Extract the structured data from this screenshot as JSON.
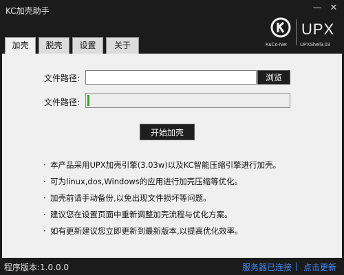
{
  "window": {
    "title": "KC加壳助手",
    "minimize_glyph": "—",
    "close_glyph": "✕"
  },
  "logo": {
    "brand": "KuCo-Net",
    "product": "UPX",
    "version": "UPXShell3.03"
  },
  "tabs": [
    {
      "label": "加壳",
      "active": true
    },
    {
      "label": "脱壳",
      "active": false
    },
    {
      "label": "设置",
      "active": false
    },
    {
      "label": "关于",
      "active": false
    }
  ],
  "main": {
    "file_path_label": "文件路径:",
    "file_path_value": "",
    "browse_label": "浏览",
    "second_label": "文件路径:",
    "progress": 0.01,
    "start_label": "开始加壳",
    "notes": [
      "本产品采用UPX加壳引擎(3.03w)以及KC智能压缩引擎进行加壳。",
      "可为linux,dos,Windows的应用进行加壳压缩等优化。",
      "加壳前请手动备份,以免出现文件损坏等问题。",
      "建议您在设置页面中重新调整加壳流程与优化方案。",
      "如有更新建议您立即更新到最新版本,以提高优化效率。"
    ]
  },
  "status": {
    "version_label": "程序版本:1.0.0.0",
    "server_status": "服务器已连接",
    "separator": "|",
    "update_link": "点击更新"
  },
  "colors": {
    "accent": "#3e86f5",
    "progress": "#2faa2f",
    "dark": "#1b1b1b"
  }
}
